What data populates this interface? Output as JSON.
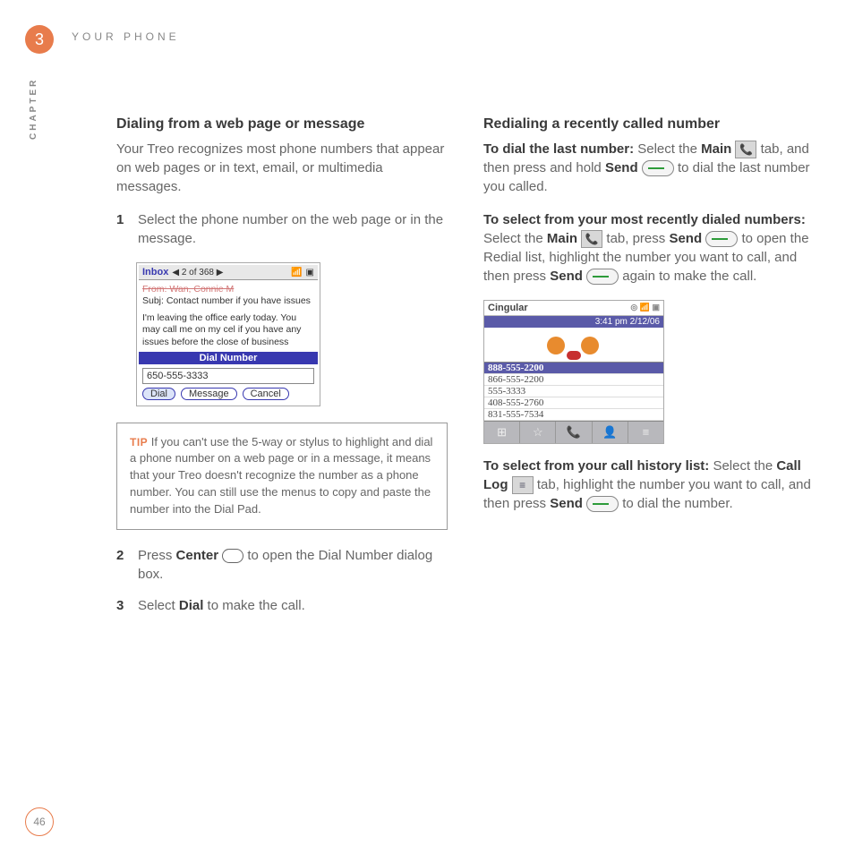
{
  "chapter_number": "3",
  "header": "YOUR PHONE",
  "chapter_label": "CHAPTER",
  "page_number": "46",
  "left": {
    "heading": "Dialing from a web page or message",
    "intro": "Your Treo recognizes most phone numbers that appear on web pages or in text, email, or multimedia messages.",
    "step1": "Select the phone number on the web page or in the message.",
    "step2a": "Press ",
    "step2b": "Center",
    "step2c": " to open the Dial Number dialog box.",
    "step3a": "Select ",
    "step3b": "Dial",
    "step3c": " to make the call.",
    "tip_label": "TIP",
    "tip": " If you can't use the 5-way or stylus to highlight and dial a phone number on a web page or in a message, it means that your Treo doesn't recognize the number as a phone number. You can still use the menus to copy and paste the number into the Dial Pad."
  },
  "right": {
    "heading": "Redialing a recently called number",
    "p1a": "To dial the last number:",
    "p1b": " Select the ",
    "p1c": "Main",
    "p1d": " tab, and then press and hold ",
    "p1e": "Send",
    "p1f": " to dial the last number you called.",
    "p2a": "To select from your most recently dialed numbers:",
    "p2b": " Select the ",
    "p2c": "Main",
    "p2d": " tab, press ",
    "p2e": "Send",
    "p2f": " to open the Redial list, highlight the number you want to call, and then press ",
    "p2g": "Send",
    "p2h": " again to make the call.",
    "p3a": "To select from your call history list:",
    "p3b": " Select the ",
    "p3c": "Call Log",
    "p3d": " tab, highlight the number you want to call, and then press ",
    "p3e": "Send",
    "p3f": " to dial the number."
  },
  "treo1": {
    "inbox": "Inbox",
    "nav": "◀ 2 of 368 ▶",
    "from": "From: Wan, Connie M",
    "subj": "Subj: Contact number if you have issues",
    "body": "I'm leaving the office early today. You may call me on my cel if you have any issues before the close of business",
    "dial_header": "Dial Number",
    "phone": "650-555-3333",
    "btn_dial": "Dial",
    "btn_msg": "Message",
    "btn_cancel": "Cancel"
  },
  "treo2": {
    "carrier": "Cingular",
    "time": "3:41 pm  2/12/06",
    "n1": "888-555-2200",
    "n2": "866-555-2200",
    "n3": "555-3333",
    "n4": "408-555-2760",
    "n5": "831-555-7534"
  }
}
